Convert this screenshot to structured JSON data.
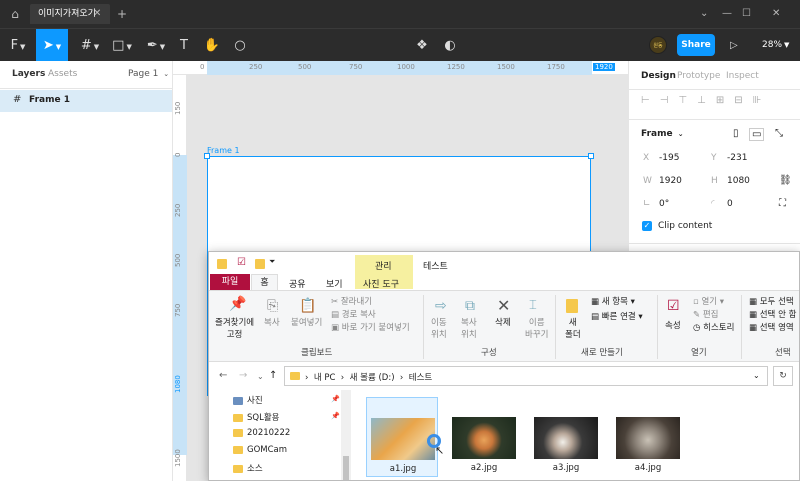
{
  "titlebar": {
    "tab_title": "이미지가져오기"
  },
  "toolbar": {
    "share_label": "Share",
    "zoom": "28%",
    "avatar_text": "원동 A3AD"
  },
  "left_panel": {
    "tabs": {
      "layers": "Layers",
      "assets": "Assets",
      "page": "Page 1"
    },
    "layers": [
      {
        "name": "Frame 1"
      }
    ]
  },
  "rulers": {
    "top": [
      "0",
      "250",
      "500",
      "750",
      "1000",
      "1250",
      "1500",
      "1750",
      "1920"
    ],
    "left": [
      "150",
      "0",
      "250",
      "500",
      "750",
      "1080",
      "1500"
    ]
  },
  "canvas": {
    "frame_label": "Frame 1"
  },
  "right_panel": {
    "tabs": {
      "design": "Design",
      "prototype": "Prototype",
      "inspect": "Inspect"
    },
    "frame_title": "Frame",
    "props": {
      "x_label": "X",
      "x": "-195",
      "y_label": "Y",
      "y": "-231",
      "w_label": "W",
      "w": "1920",
      "h_label": "H",
      "h": "1080",
      "rotation": "0°",
      "radius": "0"
    },
    "clip_content": "Clip content"
  },
  "explorer": {
    "manage_tab": "관리",
    "window_title": "테스트",
    "tabs": {
      "file": "파일",
      "home": "홈",
      "share": "공유",
      "view": "보기",
      "picture_tools": "사진 도구"
    },
    "ribbon": {
      "pin": "즐겨찾기에\n고정",
      "copy": "복사",
      "paste": "붙여넣기",
      "cut": "잘라내기",
      "copy_path": "경로 복사",
      "paste_shortcut": "바로 가기 붙여넣기",
      "group_clipboard": "클립보드",
      "move_to": "이동\n위치",
      "copy_to": "복사\n위치",
      "delete": "삭제",
      "rename": "이름\n바꾸기",
      "group_organize": "구성",
      "new_folder": "새\n폴더",
      "new_item": "새 항목",
      "easy_access": "빠른 연결",
      "group_new": "새로 만들기",
      "properties": "속성",
      "open": "열기",
      "edit": "편집",
      "history": "히스토리",
      "group_open": "열기",
      "select_all": "모두 선택",
      "select_none": "선택 안 함",
      "invert": "선택 영역",
      "group_select": "선택"
    },
    "breadcrumb": [
      "내 PC",
      "새 볼륨 (D:)",
      "테스트"
    ],
    "nav": [
      "사진",
      "SQL활용",
      "20210222",
      "GOMCam",
      "소스"
    ],
    "files": [
      "a1.jpg",
      "a2.jpg",
      "a3.jpg",
      "a4.jpg"
    ]
  },
  "colors": {
    "accent": "#0d99ff",
    "file_tab": "#b0103e",
    "manage_tab": "#f6f0a0"
  }
}
